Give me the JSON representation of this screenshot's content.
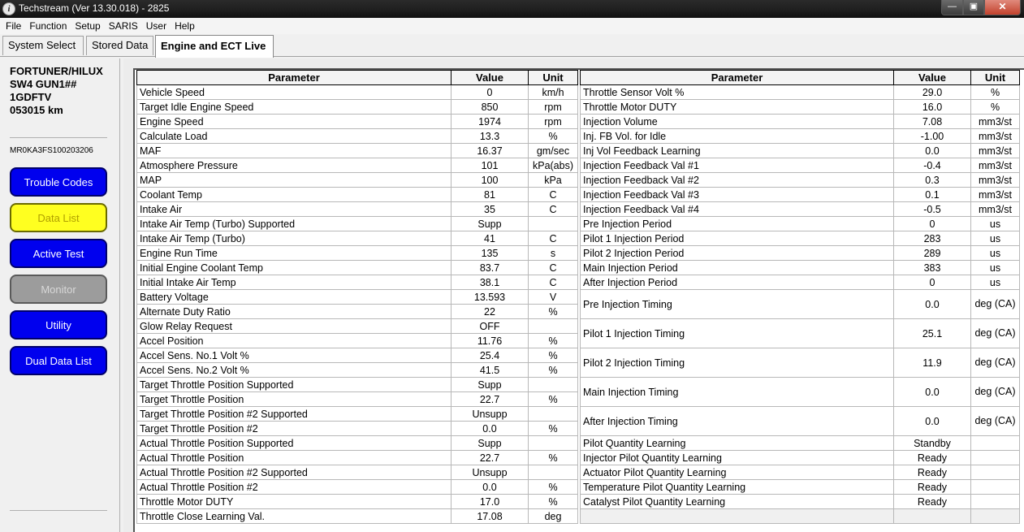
{
  "window": {
    "title": "Techstream (Ver 13.30.018) - 2825",
    "icon_letter": "i",
    "min": "—",
    "max": "▣",
    "close": "✕"
  },
  "menu": [
    "File",
    "Function",
    "Setup",
    "SARIS",
    "User",
    "Help"
  ],
  "tabs": [
    "System Select",
    "Stored Data",
    "Engine and ECT Live"
  ],
  "vehicle": {
    "line1": "FORTUNER/HILUX",
    "line2": "SW4 GUN1##",
    "line3": "1GDFTV",
    "odometer": "053015 km",
    "vin": "MR0KA3FS100203206"
  },
  "nav": [
    "Trouble Codes",
    "Data List",
    "Active Test",
    "Monitor",
    "Utility",
    "Dual Data List"
  ],
  "headers": {
    "parameter": "Parameter",
    "value": "Value",
    "unit": "Unit"
  },
  "left_rows": [
    [
      "Vehicle Speed",
      "0",
      "km/h"
    ],
    [
      "Target Idle Engine Speed",
      "850",
      "rpm"
    ],
    [
      "Engine Speed",
      "1974",
      "rpm"
    ],
    [
      "Calculate Load",
      "13.3",
      "%"
    ],
    [
      "MAF",
      "16.37",
      "gm/sec"
    ],
    [
      "Atmosphere Pressure",
      "101",
      "kPa(abs)"
    ],
    [
      "MAP",
      "100",
      "kPa"
    ],
    [
      "Coolant Temp",
      "81",
      "C"
    ],
    [
      "Intake Air",
      "35",
      "C"
    ],
    [
      "Intake Air Temp (Turbo) Supported",
      "Supp",
      ""
    ],
    [
      "Intake Air Temp (Turbo)",
      "41",
      "C"
    ],
    [
      "Engine Run Time",
      "135",
      "s"
    ],
    [
      "Initial Engine Coolant Temp",
      "83.7",
      "C"
    ],
    [
      "Initial Intake Air Temp",
      "38.1",
      "C"
    ],
    [
      "Battery Voltage",
      "13.593",
      "V"
    ],
    [
      "Alternate Duty Ratio",
      "22",
      "%"
    ],
    [
      "Glow Relay Request",
      "OFF",
      ""
    ],
    [
      "Accel Position",
      "11.76",
      "%"
    ],
    [
      "Accel Sens. No.1 Volt %",
      "25.4",
      "%"
    ],
    [
      "Accel Sens. No.2 Volt %",
      "41.5",
      "%"
    ],
    [
      "Target Throttle Position Supported",
      "Supp",
      ""
    ],
    [
      "Target Throttle Position",
      "22.7",
      "%"
    ],
    [
      "Target Throttle Position #2 Supported",
      "Unsupp",
      ""
    ],
    [
      "Target Throttle Position #2",
      "0.0",
      "%"
    ],
    [
      "Actual Throttle Position Supported",
      "Supp",
      ""
    ],
    [
      "Actual Throttle Position",
      "22.7",
      "%"
    ],
    [
      "Actual Throttle Position #2 Supported",
      "Unsupp",
      ""
    ],
    [
      "Actual Throttle Position #2",
      "0.0",
      "%"
    ],
    [
      "Throttle Motor DUTY",
      "17.0",
      "%"
    ],
    [
      "Throttle Close Learning Val.",
      "17.08",
      "deg"
    ]
  ],
  "right_rows": [
    [
      "Throttle Sensor Volt %",
      "29.0",
      "%"
    ],
    [
      "Throttle Motor DUTY",
      "16.0",
      "%"
    ],
    [
      "Injection Volume",
      "7.08",
      "mm3/st"
    ],
    [
      "Inj. FB Vol. for Idle",
      "-1.00",
      "mm3/st"
    ],
    [
      "Inj Vol Feedback Learning",
      "0.0",
      "mm3/st"
    ],
    [
      "Injection Feedback Val #1",
      "-0.4",
      "mm3/st"
    ],
    [
      "Injection Feedback Val #2",
      "0.3",
      "mm3/st"
    ],
    [
      "Injection Feedback Val #3",
      "0.1",
      "mm3/st"
    ],
    [
      "Injection Feedback Val #4",
      "-0.5",
      "mm3/st"
    ],
    [
      "Pre Injection Period",
      "0",
      "us"
    ],
    [
      "Pilot 1 Injection Period",
      "283",
      "us"
    ],
    [
      "Pilot 2 Injection Period",
      "289",
      "us"
    ],
    [
      "Main Injection Period",
      "383",
      "us"
    ],
    [
      "After Injection Period",
      "0",
      "us"
    ],
    [
      "Pre Injection Timing",
      "0.0",
      "deg (CA)"
    ],
    [
      "Pilot 1 Injection Timing",
      "25.1",
      "deg (CA)"
    ],
    [
      "Pilot 2 Injection Timing",
      "11.9",
      "deg (CA)"
    ],
    [
      "Main Injection Timing",
      "0.0",
      "deg (CA)"
    ],
    [
      "After Injection Timing",
      "0.0",
      "deg (CA)"
    ],
    [
      "Pilot Quantity Learning",
      "Standby",
      ""
    ],
    [
      "Injector Pilot Quantity Learning",
      "Ready",
      ""
    ],
    [
      "Actuator Pilot Quantity Learning",
      "Ready",
      ""
    ],
    [
      "Temperature Pilot Quantity Learning",
      "Ready",
      ""
    ],
    [
      "Catalyst Pilot Quantity Learning",
      "Ready",
      ""
    ],
    [
      "",
      "",
      ""
    ]
  ]
}
